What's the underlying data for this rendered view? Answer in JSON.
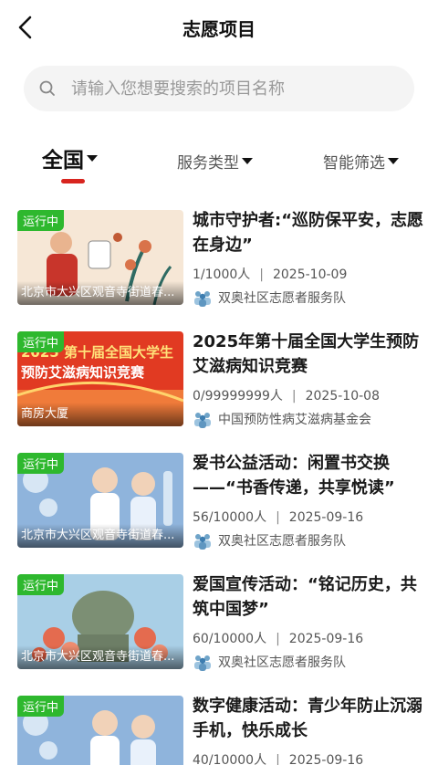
{
  "header": {
    "title": "志愿项目"
  },
  "search": {
    "placeholder": "请输入您想要搜索的项目名称"
  },
  "filters": [
    {
      "label": "全国",
      "active": true
    },
    {
      "label": "服务类型",
      "active": false
    },
    {
      "label": "智能筛选",
      "active": false
    }
  ],
  "items": [
    {
      "status": "运行中",
      "caption": "北京市大兴区观音寺街道春...",
      "title": "城市守护者:“巡防保平安，志愿在身边”",
      "count": "1/1000人",
      "date": "2025-10-09",
      "org": "双奥社区志愿者服务队"
    },
    {
      "status": "运行中",
      "caption": "商房大厦",
      "title": "2025年第十届全国大学生预防艾滋病知识竞赛",
      "count": "0/99999999人",
      "date": "2025-10-08",
      "org": "中国预防性病艾滋病基金会"
    },
    {
      "status": "运行中",
      "caption": "北京市大兴区观音寺街道春...",
      "title": "爱书公益活动：闲置书交换——“书香传递，共享悦读”",
      "count": "56/10000人",
      "date": "2025-09-16",
      "org": "双奥社区志愿者服务队"
    },
    {
      "status": "运行中",
      "caption": "北京市大兴区观音寺街道春...",
      "title": "爱国宣传活动：“铭记历史，共筑中国梦”",
      "count": "60/10000人",
      "date": "2025-09-16",
      "org": "双奥社区志愿者服务队"
    },
    {
      "status": "运行中",
      "caption": "",
      "title": "数字健康活动：青少年防止沉溺手机，快乐成长",
      "count": "40/10000人",
      "date": "2025-09-16",
      "org": ""
    }
  ],
  "thumb_text": {
    "banner_line1": "2025 第十届全国大学生",
    "banner_line2": "预防艾滋病知识竞赛"
  },
  "colors": {
    "accent": "#d8251f",
    "status": "#2eb82e"
  }
}
